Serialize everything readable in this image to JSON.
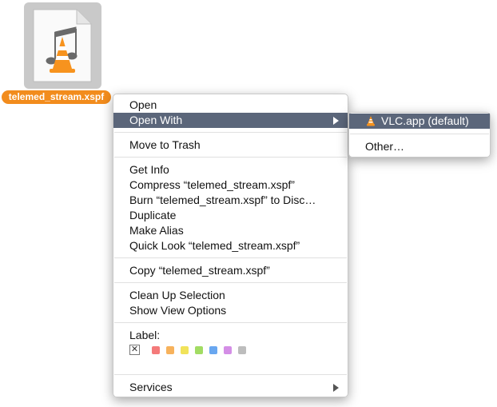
{
  "file": {
    "name": "telemed_stream.xspf",
    "icon": "vlc-playlist-document-icon"
  },
  "menu": {
    "items": [
      {
        "label": "Open"
      },
      {
        "label": "Open With",
        "submenu": true
      },
      {
        "label": "Move to Trash"
      },
      {
        "label": "Get Info"
      },
      {
        "label": "Compress “telemed_stream.xspf”"
      },
      {
        "label": "Burn “telemed_stream.xspf” to Disc…"
      },
      {
        "label": "Duplicate"
      },
      {
        "label": "Make Alias"
      },
      {
        "label": "Quick Look “telemed_stream.xspf”"
      },
      {
        "label": "Copy “telemed_stream.xspf”"
      },
      {
        "label": "Clean Up Selection"
      },
      {
        "label": "Show View Options"
      },
      {
        "label": "Label:"
      },
      {
        "label": "Services",
        "submenu": true
      }
    ],
    "highlighted": "Open With",
    "label_colors": [
      "#f47a7a",
      "#f7b25c",
      "#f1e35a",
      "#a2dc63",
      "#69a7f0",
      "#d48ee6",
      "#bdbdbd"
    ],
    "label_none_symbol": "✕"
  },
  "submenu": {
    "items": [
      {
        "label": "VLC.app (default)",
        "icon": "vlc-cone-icon"
      },
      {
        "label": "Other…"
      }
    ],
    "highlighted": "VLC.app (default)"
  },
  "colors": {
    "highlight": "#5b667a",
    "file_label_bg": "#f28c1d"
  }
}
